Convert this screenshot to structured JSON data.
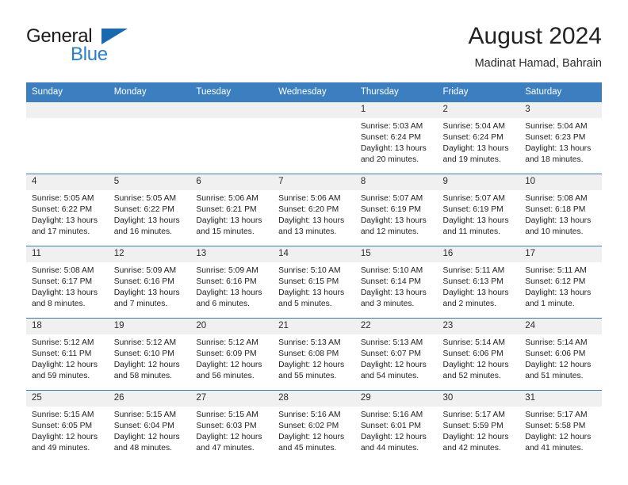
{
  "brand": {
    "name_part1": "General",
    "name_part2": "Blue",
    "triangle_color": "#1769b0",
    "blue_color": "#2a7fc9"
  },
  "header": {
    "title": "August 2024",
    "subtitle": "Madinat Hamad, Bahrain"
  },
  "theme": {
    "header_blue": "#3c7fc1",
    "daynum_bg": "#f0f0f0",
    "text": "#222222"
  },
  "weekdays": [
    "Sunday",
    "Monday",
    "Tuesday",
    "Wednesday",
    "Thursday",
    "Friday",
    "Saturday"
  ],
  "weeks": [
    [
      {
        "day": "",
        "sunrise": "",
        "sunset": "",
        "daylight1": "",
        "daylight2": ""
      },
      {
        "day": "",
        "sunrise": "",
        "sunset": "",
        "daylight1": "",
        "daylight2": ""
      },
      {
        "day": "",
        "sunrise": "",
        "sunset": "",
        "daylight1": "",
        "daylight2": ""
      },
      {
        "day": "",
        "sunrise": "",
        "sunset": "",
        "daylight1": "",
        "daylight2": ""
      },
      {
        "day": "1",
        "sunrise": "Sunrise: 5:03 AM",
        "sunset": "Sunset: 6:24 PM",
        "daylight1": "Daylight: 13 hours",
        "daylight2": "and 20 minutes."
      },
      {
        "day": "2",
        "sunrise": "Sunrise: 5:04 AM",
        "sunset": "Sunset: 6:24 PM",
        "daylight1": "Daylight: 13 hours",
        "daylight2": "and 19 minutes."
      },
      {
        "day": "3",
        "sunrise": "Sunrise: 5:04 AM",
        "sunset": "Sunset: 6:23 PM",
        "daylight1": "Daylight: 13 hours",
        "daylight2": "and 18 minutes."
      }
    ],
    [
      {
        "day": "4",
        "sunrise": "Sunrise: 5:05 AM",
        "sunset": "Sunset: 6:22 PM",
        "daylight1": "Daylight: 13 hours",
        "daylight2": "and 17 minutes."
      },
      {
        "day": "5",
        "sunrise": "Sunrise: 5:05 AM",
        "sunset": "Sunset: 6:22 PM",
        "daylight1": "Daylight: 13 hours",
        "daylight2": "and 16 minutes."
      },
      {
        "day": "6",
        "sunrise": "Sunrise: 5:06 AM",
        "sunset": "Sunset: 6:21 PM",
        "daylight1": "Daylight: 13 hours",
        "daylight2": "and 15 minutes."
      },
      {
        "day": "7",
        "sunrise": "Sunrise: 5:06 AM",
        "sunset": "Sunset: 6:20 PM",
        "daylight1": "Daylight: 13 hours",
        "daylight2": "and 13 minutes."
      },
      {
        "day": "8",
        "sunrise": "Sunrise: 5:07 AM",
        "sunset": "Sunset: 6:19 PM",
        "daylight1": "Daylight: 13 hours",
        "daylight2": "and 12 minutes."
      },
      {
        "day": "9",
        "sunrise": "Sunrise: 5:07 AM",
        "sunset": "Sunset: 6:19 PM",
        "daylight1": "Daylight: 13 hours",
        "daylight2": "and 11 minutes."
      },
      {
        "day": "10",
        "sunrise": "Sunrise: 5:08 AM",
        "sunset": "Sunset: 6:18 PM",
        "daylight1": "Daylight: 13 hours",
        "daylight2": "and 10 minutes."
      }
    ],
    [
      {
        "day": "11",
        "sunrise": "Sunrise: 5:08 AM",
        "sunset": "Sunset: 6:17 PM",
        "daylight1": "Daylight: 13 hours",
        "daylight2": "and 8 minutes."
      },
      {
        "day": "12",
        "sunrise": "Sunrise: 5:09 AM",
        "sunset": "Sunset: 6:16 PM",
        "daylight1": "Daylight: 13 hours",
        "daylight2": "and 7 minutes."
      },
      {
        "day": "13",
        "sunrise": "Sunrise: 5:09 AM",
        "sunset": "Sunset: 6:16 PM",
        "daylight1": "Daylight: 13 hours",
        "daylight2": "and 6 minutes."
      },
      {
        "day": "14",
        "sunrise": "Sunrise: 5:10 AM",
        "sunset": "Sunset: 6:15 PM",
        "daylight1": "Daylight: 13 hours",
        "daylight2": "and 5 minutes."
      },
      {
        "day": "15",
        "sunrise": "Sunrise: 5:10 AM",
        "sunset": "Sunset: 6:14 PM",
        "daylight1": "Daylight: 13 hours",
        "daylight2": "and 3 minutes."
      },
      {
        "day": "16",
        "sunrise": "Sunrise: 5:11 AM",
        "sunset": "Sunset: 6:13 PM",
        "daylight1": "Daylight: 13 hours",
        "daylight2": "and 2 minutes."
      },
      {
        "day": "17",
        "sunrise": "Sunrise: 5:11 AM",
        "sunset": "Sunset: 6:12 PM",
        "daylight1": "Daylight: 13 hours",
        "daylight2": "and 1 minute."
      }
    ],
    [
      {
        "day": "18",
        "sunrise": "Sunrise: 5:12 AM",
        "sunset": "Sunset: 6:11 PM",
        "daylight1": "Daylight: 12 hours",
        "daylight2": "and 59 minutes."
      },
      {
        "day": "19",
        "sunrise": "Sunrise: 5:12 AM",
        "sunset": "Sunset: 6:10 PM",
        "daylight1": "Daylight: 12 hours",
        "daylight2": "and 58 minutes."
      },
      {
        "day": "20",
        "sunrise": "Sunrise: 5:12 AM",
        "sunset": "Sunset: 6:09 PM",
        "daylight1": "Daylight: 12 hours",
        "daylight2": "and 56 minutes."
      },
      {
        "day": "21",
        "sunrise": "Sunrise: 5:13 AM",
        "sunset": "Sunset: 6:08 PM",
        "daylight1": "Daylight: 12 hours",
        "daylight2": "and 55 minutes."
      },
      {
        "day": "22",
        "sunrise": "Sunrise: 5:13 AM",
        "sunset": "Sunset: 6:07 PM",
        "daylight1": "Daylight: 12 hours",
        "daylight2": "and 54 minutes."
      },
      {
        "day": "23",
        "sunrise": "Sunrise: 5:14 AM",
        "sunset": "Sunset: 6:06 PM",
        "daylight1": "Daylight: 12 hours",
        "daylight2": "and 52 minutes."
      },
      {
        "day": "24",
        "sunrise": "Sunrise: 5:14 AM",
        "sunset": "Sunset: 6:06 PM",
        "daylight1": "Daylight: 12 hours",
        "daylight2": "and 51 minutes."
      }
    ],
    [
      {
        "day": "25",
        "sunrise": "Sunrise: 5:15 AM",
        "sunset": "Sunset: 6:05 PM",
        "daylight1": "Daylight: 12 hours",
        "daylight2": "and 49 minutes."
      },
      {
        "day": "26",
        "sunrise": "Sunrise: 5:15 AM",
        "sunset": "Sunset: 6:04 PM",
        "daylight1": "Daylight: 12 hours",
        "daylight2": "and 48 minutes."
      },
      {
        "day": "27",
        "sunrise": "Sunrise: 5:15 AM",
        "sunset": "Sunset: 6:03 PM",
        "daylight1": "Daylight: 12 hours",
        "daylight2": "and 47 minutes."
      },
      {
        "day": "28",
        "sunrise": "Sunrise: 5:16 AM",
        "sunset": "Sunset: 6:02 PM",
        "daylight1": "Daylight: 12 hours",
        "daylight2": "and 45 minutes."
      },
      {
        "day": "29",
        "sunrise": "Sunrise: 5:16 AM",
        "sunset": "Sunset: 6:01 PM",
        "daylight1": "Daylight: 12 hours",
        "daylight2": "and 44 minutes."
      },
      {
        "day": "30",
        "sunrise": "Sunrise: 5:17 AM",
        "sunset": "Sunset: 5:59 PM",
        "daylight1": "Daylight: 12 hours",
        "daylight2": "and 42 minutes."
      },
      {
        "day": "31",
        "sunrise": "Sunrise: 5:17 AM",
        "sunset": "Sunset: 5:58 PM",
        "daylight1": "Daylight: 12 hours",
        "daylight2": "and 41 minutes."
      }
    ]
  ]
}
